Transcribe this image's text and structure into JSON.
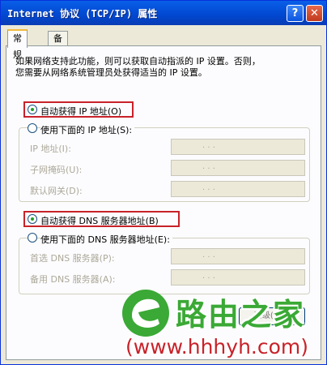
{
  "window": {
    "title": "Internet 协议 (TCP/IP) 属性",
    "help_glyph": "?",
    "close_glyph": "✕"
  },
  "tabs": [
    {
      "label": "常规",
      "active": true
    },
    {
      "label": "备用配置",
      "active": false
    }
  ],
  "description": {
    "line1": "如果网络支持此功能，则可以获取自动指派的 IP 设置。否则，",
    "line2": "您需要从网络系统管理员处获得适当的 IP 设置。"
  },
  "ip_section": {
    "auto_label": "自动获得 IP 地址(O)",
    "manual_label": "使用下面的 IP 地址(S):",
    "fields": [
      {
        "label": "IP 地址(I):",
        "value": ". . ."
      },
      {
        "label": "子网掩码(U):",
        "value": ". . ."
      },
      {
        "label": "默认网关(D):",
        "value": ". . ."
      }
    ]
  },
  "dns_section": {
    "auto_label": "自动获得 DNS 服务器地址(B)",
    "manual_label": "使用下面的 DNS 服务器地址(E):",
    "fields": [
      {
        "label": "首选 DNS 服务器(P):",
        "value": ". . ."
      },
      {
        "label": "备用 DNS 服务器(A):",
        "value": ". . ."
      }
    ]
  },
  "advanced_partial": "高级(V)...",
  "watermark": {
    "brand": "路由之家",
    "url": "(www.hhhyh.com)"
  },
  "colors": {
    "titlebar": "#0147d0",
    "highlight_box": "#c8222a",
    "watermark_green": "#3aa935",
    "watermark_red": "#c8222a"
  }
}
